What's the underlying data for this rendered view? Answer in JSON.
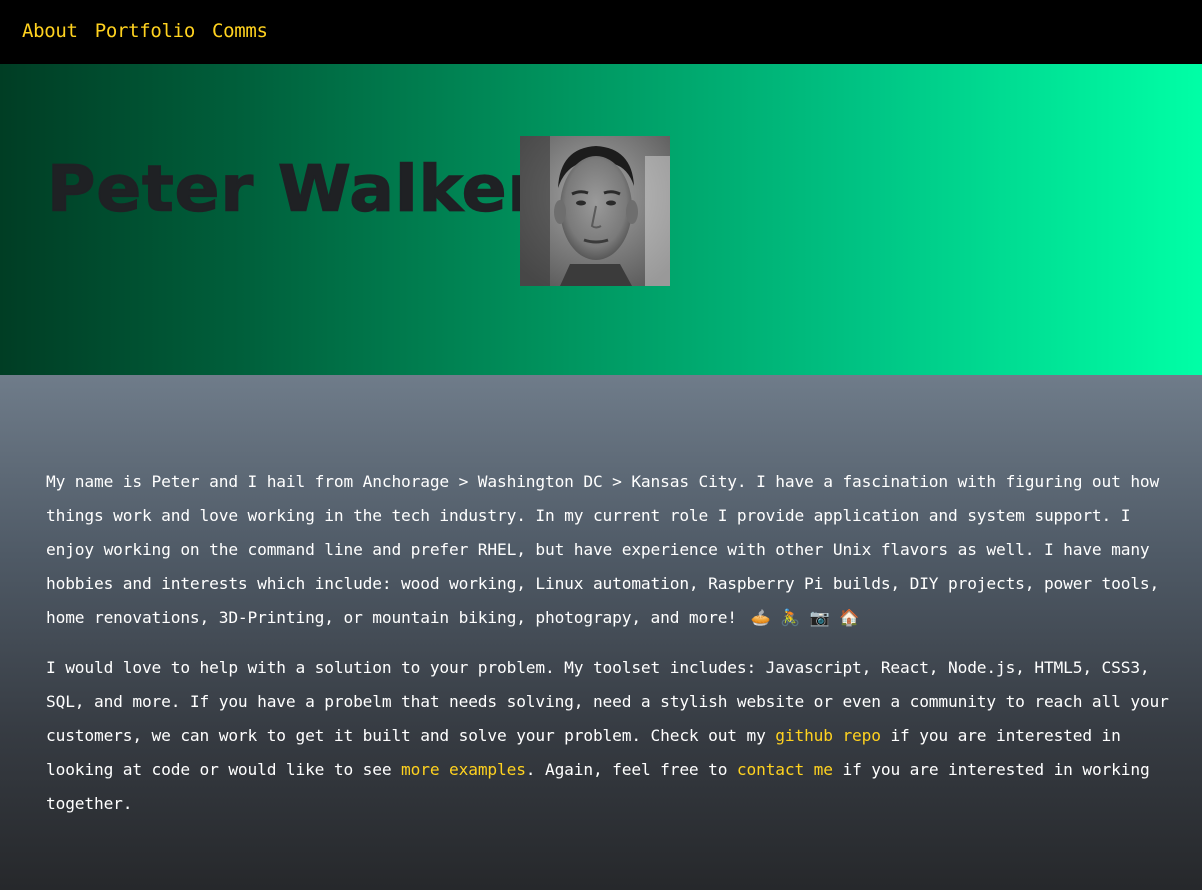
{
  "nav": {
    "items": [
      {
        "label": "About"
      },
      {
        "label": "Portfolio"
      },
      {
        "label": "Comms"
      }
    ],
    "link_color": "#ffd21f"
  },
  "hero": {
    "name": "Peter Walker",
    "avatar_alt": "profile-photo",
    "gradient_start": "#003d24",
    "gradient_end": "#00ffa6"
  },
  "about": {
    "p1_text": "My name is Peter and I hail from Anchorage > Washington DC > Kansas City. I have a fascination with figuring out how things work and love working in the tech industry. In my current role I provide application and system support. I enjoy working on the command line and prefer RHEL, but have experience with other Unix flavors as well. I have many hobbies and interests which include: wood working, Linux automation, Raspberry Pi builds, DIY projects, power tools, home renovations, 3D-Printing, or mountain biking, photograpy, and more!",
    "p1_emojis": "🥧 🚴 📷 🏠",
    "p2_part1": "I would love to help with a solution to your problem. My toolset includes: Javascript, React, Node.js, HTML5, CSS3, SQL, and more. If you have a probelm that needs solving, need a stylish website or even a community to reach all your customers, we can work to get it built and solve your problem. Check out my ",
    "github_link": "github repo",
    "p2_part2": " if you are interested in looking at code or would like to see ",
    "examples_link": "more examples",
    "p2_part3": ". Again, feel free to ",
    "contact_link": "contact me",
    "p2_part4": " if you are interested in working together."
  }
}
